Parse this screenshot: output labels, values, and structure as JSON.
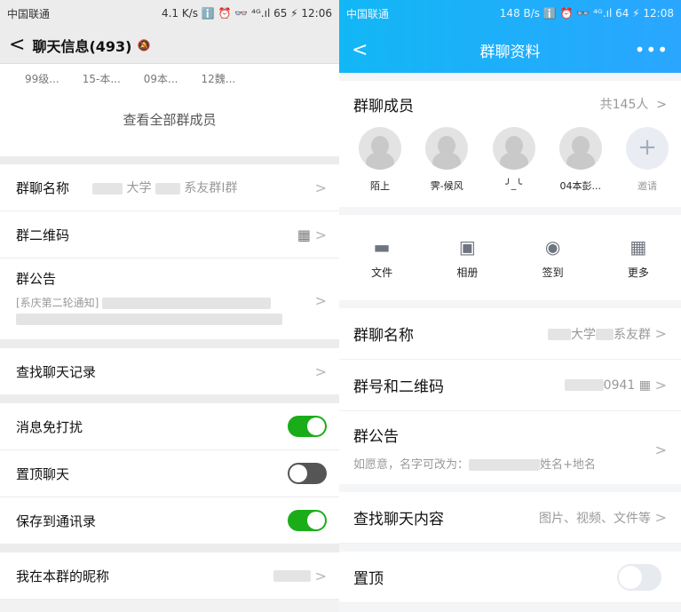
{
  "left": {
    "status": {
      "carrier": "中国联通",
      "right": "4.1 K/s ℹ️ ⏰ 👓 ⁴ᴳ.ıl 65 ⚡ 12:06"
    },
    "header": {
      "back": "<",
      "title": "聊天信息(493)"
    },
    "member_names": [
      "99级...",
      "15-本...",
      "09本...",
      "12魏..."
    ],
    "view_all": "查看全部群成员",
    "rows": {
      "group_name": {
        "label": "群聊名称",
        "value_a": "大学",
        "value_b": "系友群I群"
      },
      "qr": {
        "label": "群二维码"
      },
      "notice": {
        "label": "群公告",
        "preview": "[系庆第二轮通知]"
      },
      "search": {
        "label": "查找聊天记录"
      },
      "mute": {
        "label": "消息免打扰",
        "on": true
      },
      "pin": {
        "label": "置顶聊天",
        "on": false
      },
      "save": {
        "label": "保存到通讯录",
        "on": true
      },
      "nick": {
        "label": "我在本群的昵称"
      }
    }
  },
  "right": {
    "status": {
      "carrier": "中国联通",
      "right": "148 B/s ℹ️ ⏰ 👓 ⁴ᴳ.ıl 64 ⚡ 12:08"
    },
    "nav": {
      "back": "<",
      "title": "群聊资料",
      "more": "•••"
    },
    "members": {
      "title": "群聊成员",
      "count": "共145人",
      "list": [
        "陌上",
        "霁-候风",
        "╯_╰",
        "04本彭..."
      ],
      "invite": "邀请"
    },
    "tools": [
      {
        "icon": "folder-icon",
        "label": "文件"
      },
      {
        "icon": "image-icon",
        "label": "相册"
      },
      {
        "icon": "checkin-icon",
        "label": "签到"
      },
      {
        "icon": "grid-icon",
        "label": "更多"
      }
    ],
    "rows": {
      "group_name": {
        "label": "群聊名称",
        "value_a": "大学",
        "value_b": "系友群"
      },
      "group_id": {
        "label": "群号和二维码",
        "value": "0941"
      },
      "notice": {
        "label": "群公告",
        "desc_a": "如愿意，名字可改为：",
        "desc_b": "姓名+地名"
      },
      "search": {
        "label": "查找聊天内容",
        "value": "图片、视频、文件等"
      },
      "pin": {
        "label": "置顶",
        "on": false
      }
    }
  }
}
